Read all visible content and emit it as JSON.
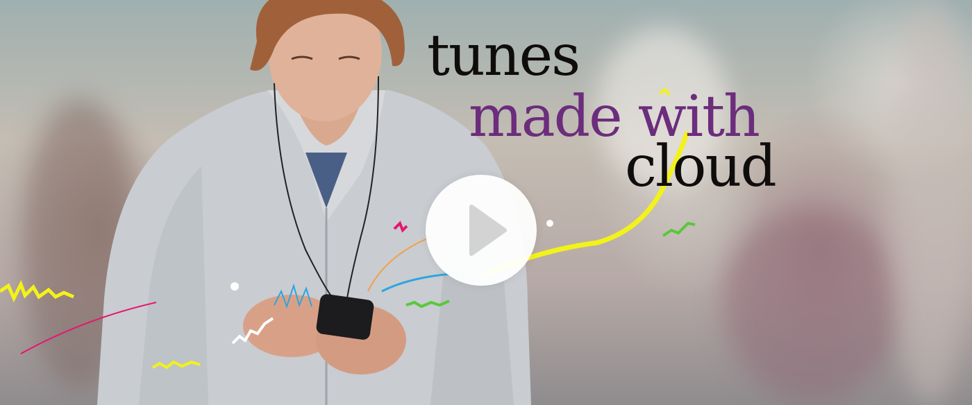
{
  "hero": {
    "headline": {
      "line1": "tunes",
      "line2": "made with",
      "line3": "cloud"
    },
    "play_icon": "play-icon"
  },
  "colors": {
    "headline_dark": "#0f0c0c",
    "headline_accent": "#6b2d7c",
    "play_button_bg": "#ffffff",
    "play_icon": "#cfcfcf",
    "scribble_yellow": "#f3f21a",
    "scribble_blue": "#2aa6e0",
    "scribble_pink": "#e6166f",
    "scribble_green": "#59c83a"
  }
}
